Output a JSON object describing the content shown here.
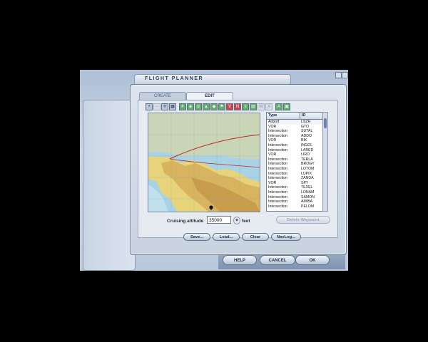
{
  "dialog": {
    "title": "FLIGHT PLANNER",
    "tabs": [
      "CREATE",
      "EDIT"
    ],
    "active_tab": "EDIT"
  },
  "toolbar": {
    "icons": [
      "zoom-in-icon",
      "zoom-out-icon",
      "center-icon",
      "pan-icon",
      "airport-icon",
      "vor-icon",
      "ndb-icon",
      "intersection-icon",
      "waypoint-icon",
      "flag-icon",
      "red-v-icon",
      "red-n-icon",
      "green-icon",
      "green-icon-2",
      "wx-icon",
      "x-icon",
      "green-a-icon",
      "green-b-icon"
    ]
  },
  "waypoints": {
    "headers": [
      "Type",
      "ID"
    ],
    "rows": [
      [
        "Airport",
        "LSZH"
      ],
      [
        "VOR",
        "GTO"
      ],
      [
        "Intersection",
        "SUTAL"
      ],
      [
        "Intersection",
        "ADDO"
      ],
      [
        "VOR",
        "BIK"
      ],
      [
        "Intersection",
        "INGOL"
      ],
      [
        "Intersection",
        "LARED"
      ],
      [
        "VOR",
        "LIRO"
      ],
      [
        "Intersection",
        "TERLA"
      ],
      [
        "Intersection",
        "BROGY"
      ],
      [
        "Intersection",
        "LOTOM"
      ],
      [
        "Intersection",
        "LUPIX"
      ],
      [
        "Intersection",
        "ZANDA"
      ],
      [
        "VOR",
        "SPY"
      ],
      [
        "Intersection",
        "TEXEL"
      ],
      [
        "Intersection",
        "LONAM"
      ],
      [
        "Intersection",
        "SAMON"
      ],
      [
        "Intersection",
        "AMIBA"
      ],
      [
        "Intersection",
        "PELOM"
      ]
    ]
  },
  "altitude": {
    "label": "Cruising altitude",
    "value": "35000",
    "unit": "feet"
  },
  "buttons": {
    "delete_waypoint": "Delete Waypoint",
    "save": "Save...",
    "load": "Load...",
    "clear": "Clear",
    "navlog": "NavLog..."
  },
  "footer": {
    "help": "HELP",
    "cancel": "CANCEL",
    "ok": "OK"
  },
  "colors": {
    "route": "#c0281e",
    "water": "#a8d3e6",
    "land": "#e7d47a"
  }
}
